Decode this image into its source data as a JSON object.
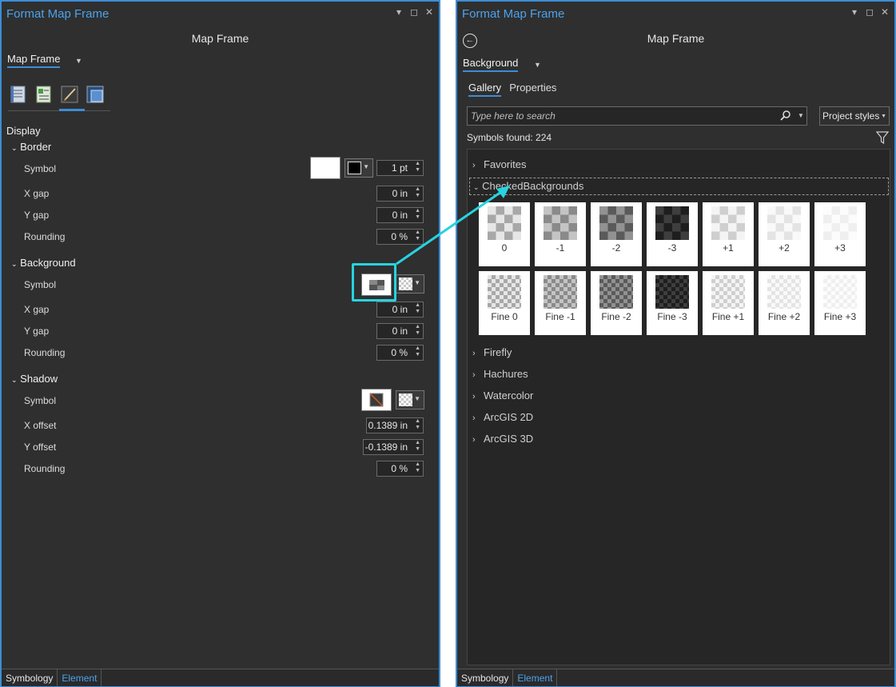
{
  "left": {
    "title": "Format Map Frame",
    "subtitle": "Map Frame",
    "dropdown": "Map Frame",
    "display_header": "Display",
    "border": {
      "header": "Border",
      "symbol_label": "Symbol",
      "symbol_width": "1 pt",
      "xgap_label": "X gap",
      "xgap": "0 in",
      "ygap_label": "Y gap",
      "ygap": "0 in",
      "rounding_label": "Rounding",
      "rounding": "0 %"
    },
    "background": {
      "header": "Background",
      "symbol_label": "Symbol",
      "xgap_label": "X gap",
      "xgap": "0 in",
      "ygap_label": "Y gap",
      "ygap": "0 in",
      "rounding_label": "Rounding",
      "rounding": "0 %"
    },
    "shadow": {
      "header": "Shadow",
      "symbol_label": "Symbol",
      "xoffset_label": "X offset",
      "xoffset": "0.1389 in",
      "yoffset_label": "Y offset",
      "yoffset": "-0.1389 in",
      "rounding_label": "Rounding",
      "rounding": "0 %"
    },
    "footer": {
      "tab1": "Symbology",
      "tab2": "Element"
    }
  },
  "right": {
    "title": "Format Map Frame",
    "subtitle": "Map Frame",
    "dropdown": "Background",
    "tab_gallery": "Gallery",
    "tab_properties": "Properties",
    "search_placeholder": "Type here to search",
    "style_select": "Project styles",
    "symbols_found": "Symbols found: 224",
    "categories": {
      "favorites": "Favorites",
      "checked": "CheckedBackgrounds",
      "firefly": "Firefly",
      "hachures": "Hachures",
      "watercolor": "Watercolor",
      "arcgis2d": "ArcGIS 2D",
      "arcgis3d": "ArcGIS 3D"
    },
    "tiles_row1": [
      "0",
      "-1",
      "-2",
      "-3",
      "+1",
      "+2",
      "+3"
    ],
    "tiles_row2": [
      "Fine 0",
      "Fine -1",
      "Fine -2",
      "Fine -3",
      "Fine +1",
      "Fine +2",
      "Fine +3"
    ],
    "footer": {
      "tab1": "Symbology",
      "tab2": "Element"
    }
  },
  "colors": {
    "accent": "#3c8dd6",
    "highlight": "#27d3e0",
    "panel_bg": "#2f2f2f"
  }
}
